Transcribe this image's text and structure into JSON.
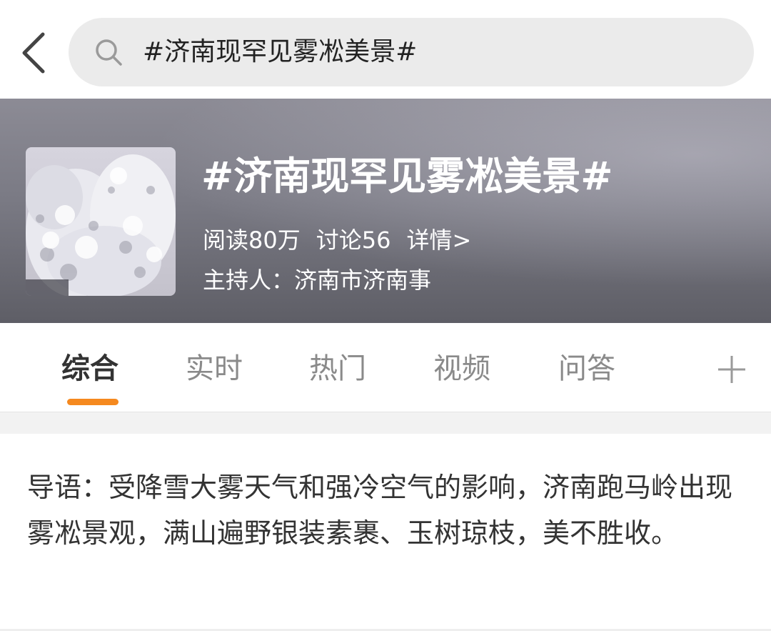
{
  "search": {
    "query": "#济南现罕见雾凇美景#"
  },
  "topic": {
    "title": "#济南现罕见雾凇美景#",
    "reads": "阅读80万",
    "discussions": "讨论56",
    "details": "详情>",
    "host": "主持人：济南市济南事"
  },
  "tabs": [
    {
      "label": "综合"
    },
    {
      "label": "实时"
    },
    {
      "label": "热门"
    },
    {
      "label": "视频"
    },
    {
      "label": "问答"
    }
  ],
  "intro": {
    "text": "导语：受降雪大雾天气和强冷空气的影响，济南跑马岭出现雾凇景观，满山遍野银装素裹、玉树琼枝，美不胜收。"
  },
  "icons": {
    "back": "chevron-left-icon",
    "search": "search-icon",
    "add": "plus-icon"
  },
  "colors": {
    "accent": "#f5891f",
    "search_bg": "#ebebeb",
    "banner": "#7a7a84"
  }
}
